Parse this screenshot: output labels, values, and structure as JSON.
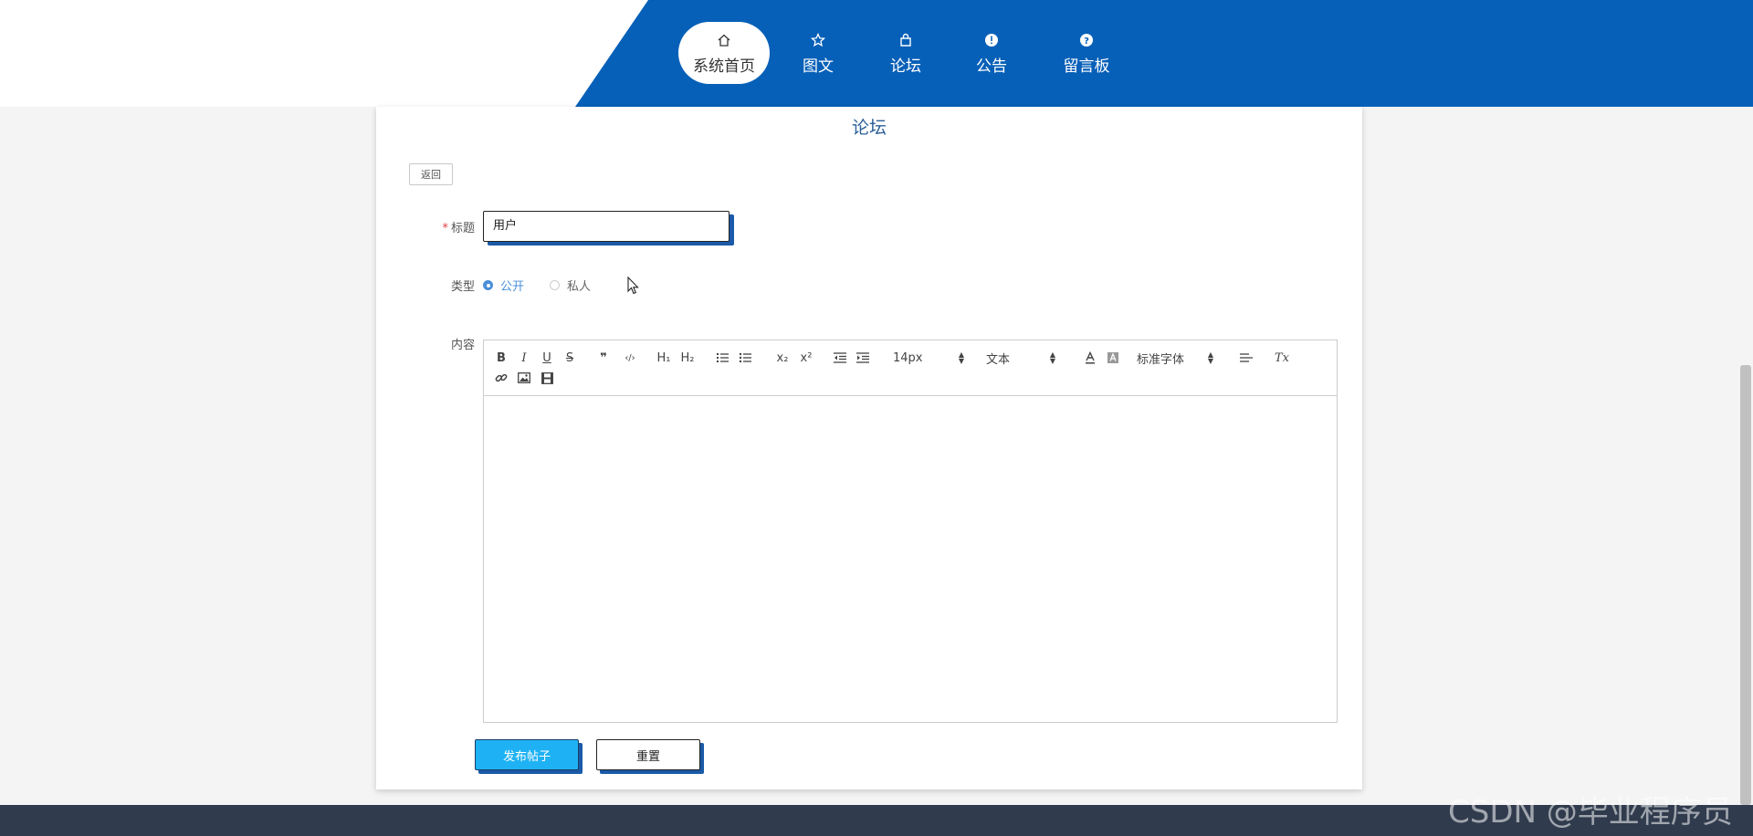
{
  "nav": {
    "items": [
      {
        "label": "系统首页",
        "icon": "home-icon",
        "active": true
      },
      {
        "label": "图文",
        "icon": "star-icon",
        "active": false
      },
      {
        "label": "论坛",
        "icon": "bag-icon",
        "active": false
      },
      {
        "label": "公告",
        "icon": "alert-circle-icon",
        "active": false
      },
      {
        "label": "留言板",
        "icon": "help-circle-icon",
        "active": false
      }
    ]
  },
  "page": {
    "title": "论坛",
    "back_label": "返回"
  },
  "form": {
    "title_label": "标题",
    "title_value": "用户",
    "type_label": "类型",
    "type_options": [
      {
        "label": "公开",
        "selected": true
      },
      {
        "label": "私人",
        "selected": false
      }
    ],
    "content_label": "内容",
    "submit_label": "发布帖子",
    "reset_label": "重置"
  },
  "editor": {
    "buttons": {
      "bold": "B",
      "italic": "I",
      "underline": "U",
      "strike": "S",
      "quote": "❞",
      "code": "‹/›",
      "h1": "H₁",
      "h2": "H₂",
      "subscript": "x₂",
      "superscript": "x²",
      "clear": "Tx"
    },
    "font_size": "14px",
    "header": "文本",
    "font_family": "标准字体"
  },
  "watermark": "CSDN @毕业程序员",
  "colors": {
    "nav": "#0760b8",
    "accent": "#4a90d9",
    "submit": "#1eb2f4",
    "footer": "#303b4d"
  }
}
